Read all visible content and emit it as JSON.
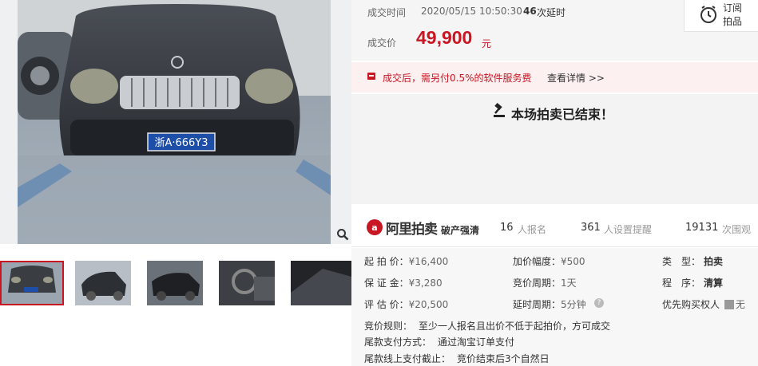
{
  "gallery": {
    "main_image_alt": "",
    "plate_text": "浙A·666Y3",
    "thumbnails": [
      {
        "name": "thumb-1",
        "selected": true
      },
      {
        "name": "thumb-2",
        "selected": false
      },
      {
        "name": "thumb-3",
        "selected": false
      },
      {
        "name": "thumb-4",
        "selected": false
      },
      {
        "name": "thumb-5",
        "selected": false
      }
    ]
  },
  "deal": {
    "time_label": "成交时间",
    "time_value": "2020/05/15 10:50:30",
    "delay_count": "46",
    "delay_label": "次延时",
    "price_label": "成交价",
    "price_value": "49,900",
    "price_unit": "元"
  },
  "subscribe": {
    "label": "订阅拍品"
  },
  "fee_notice": {
    "text": "成交后，需另付0.5%的软件服务费",
    "link": "查看详情 >>"
  },
  "auction_status": {
    "text": "本场拍卖已结束！"
  },
  "brand": {
    "name": "阿里拍卖",
    "tag": "破产强清"
  },
  "stats": [
    {
      "value": "16",
      "label": "人报名"
    },
    {
      "value": "361",
      "label": "人设置提醒"
    },
    {
      "value": "19131",
      "label": "次围观"
    }
  ],
  "details": {
    "col1": [
      {
        "key": "起 拍 价：",
        "value": "¥16,400"
      },
      {
        "key": "保 证 金：",
        "value": "¥3,280"
      },
      {
        "key": "评 估 价：",
        "value": "¥20,500"
      }
    ],
    "col2": [
      {
        "key": "加价幅度：",
        "value": "¥500"
      },
      {
        "key": "竞价周期：",
        "value": "1天"
      },
      {
        "key": "延时周期：",
        "value": "5分钟"
      }
    ],
    "col3": [
      {
        "key": "类　型：",
        "value": "拍卖"
      },
      {
        "key": "程　序：",
        "value": "清算"
      },
      {
        "key": "优先购买权人",
        "value": "无"
      }
    ]
  },
  "rules": [
    {
      "key": "竞价规则：",
      "value": "至少一人报名且出价不低于起拍价，方可成交"
    },
    {
      "key": "尾款支付方式：",
      "value": "通过淘宝订单支付"
    },
    {
      "key": "尾款线上支付截止：",
      "value": "竞价结束后3个自然日"
    }
  ],
  "colors": {
    "accent": "#c81623",
    "fee_bg": "#fdf0f0",
    "panel_bg": "#f5f5f5"
  }
}
